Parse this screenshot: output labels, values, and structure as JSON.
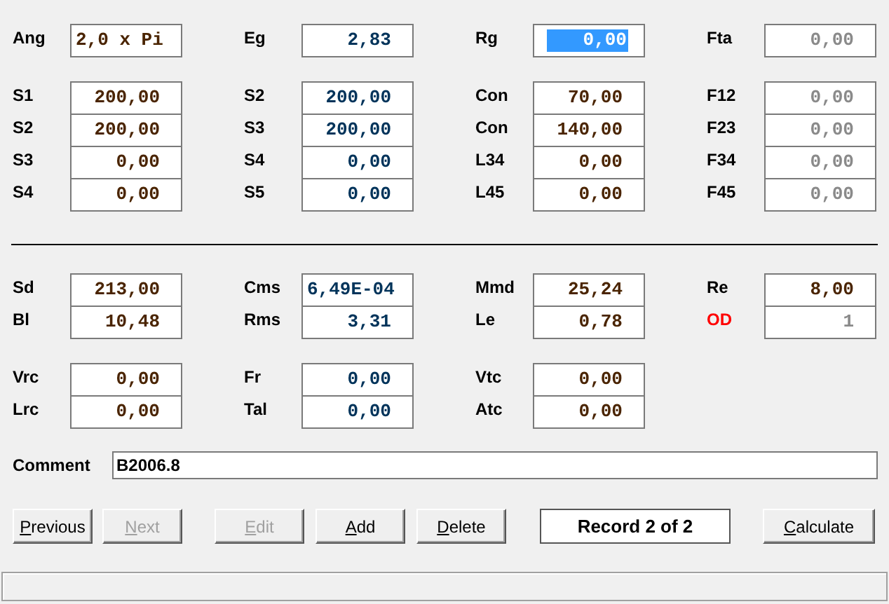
{
  "groups": [
    {
      "rows": [
        [
          {
            "label": "Ang",
            "value": "2,0 x Pi",
            "kind": "text",
            "disabled": false,
            "focused": false,
            "alert": false
          },
          {
            "label": "Eg",
            "value": "2,83",
            "kind": "number",
            "disabled": false,
            "focused": false,
            "alert": false
          },
          {
            "label": "Rg",
            "value": "0,00",
            "kind": "number",
            "disabled": false,
            "focused": true,
            "alert": false
          },
          {
            "label": "Fta",
            "value": "0,00",
            "kind": "number",
            "disabled": true,
            "focused": false,
            "alert": false
          }
        ]
      ]
    },
    {
      "rows": [
        [
          {
            "label": "S1",
            "value": "200,00",
            "kind": "number",
            "disabled": false,
            "focused": false,
            "alert": false
          },
          {
            "label": "S2",
            "value": "200,00",
            "kind": "number",
            "disabled": false,
            "focused": false,
            "alert": false
          },
          {
            "label": "Con",
            "value": "70,00",
            "kind": "number",
            "disabled": false,
            "focused": false,
            "alert": false
          },
          {
            "label": "F12",
            "value": "0,00",
            "kind": "number",
            "disabled": true,
            "focused": false,
            "alert": false
          }
        ],
        [
          {
            "label": "S2",
            "value": "200,00",
            "kind": "number",
            "disabled": false,
            "focused": false,
            "alert": false
          },
          {
            "label": "S3",
            "value": "200,00",
            "kind": "number",
            "disabled": false,
            "focused": false,
            "alert": false
          },
          {
            "label": "Con",
            "value": "140,00",
            "kind": "number",
            "disabled": false,
            "focused": false,
            "alert": false
          },
          {
            "label": "F23",
            "value": "0,00",
            "kind": "number",
            "disabled": true,
            "focused": false,
            "alert": false
          }
        ],
        [
          {
            "label": "S3",
            "value": "0,00",
            "kind": "number",
            "disabled": false,
            "focused": false,
            "alert": false
          },
          {
            "label": "S4",
            "value": "0,00",
            "kind": "number",
            "disabled": false,
            "focused": false,
            "alert": false
          },
          {
            "label": "L34",
            "value": "0,00",
            "kind": "number",
            "disabled": false,
            "focused": false,
            "alert": false
          },
          {
            "label": "F34",
            "value": "0,00",
            "kind": "number",
            "disabled": true,
            "focused": false,
            "alert": false
          }
        ],
        [
          {
            "label": "S4",
            "value": "0,00",
            "kind": "number",
            "disabled": false,
            "focused": false,
            "alert": false
          },
          {
            "label": "S5",
            "value": "0,00",
            "kind": "number",
            "disabled": false,
            "focused": false,
            "alert": false
          },
          {
            "label": "L45",
            "value": "0,00",
            "kind": "number",
            "disabled": false,
            "focused": false,
            "alert": false
          },
          {
            "label": "F45",
            "value": "0,00",
            "kind": "number",
            "disabled": true,
            "focused": false,
            "alert": false
          }
        ]
      ]
    },
    {
      "rows": [
        [
          {
            "label": "Sd",
            "value": "213,00",
            "kind": "number",
            "disabled": false,
            "focused": false,
            "alert": false
          },
          {
            "label": "Cms",
            "value": "6,49E-04",
            "kind": "text",
            "disabled": false,
            "focused": false,
            "alert": false
          },
          {
            "label": "Mmd",
            "value": "25,24",
            "kind": "number",
            "disabled": false,
            "focused": false,
            "alert": false
          },
          {
            "label": "Re",
            "value": "8,00",
            "kind": "number",
            "disabled": false,
            "focused": false,
            "alert": false
          }
        ],
        [
          {
            "label": "Bl",
            "value": "10,48",
            "kind": "number",
            "disabled": false,
            "focused": false,
            "alert": false
          },
          {
            "label": "Rms",
            "value": "3,31",
            "kind": "number",
            "disabled": false,
            "focused": false,
            "alert": false
          },
          {
            "label": "Le",
            "value": "0,78",
            "kind": "number",
            "disabled": false,
            "focused": false,
            "alert": false
          },
          {
            "label": "OD",
            "value": "1",
            "kind": "number",
            "disabled": true,
            "focused": false,
            "alert": true
          }
        ]
      ]
    },
    {
      "rows": [
        [
          {
            "label": "Vrc",
            "value": "0,00",
            "kind": "number",
            "disabled": false,
            "focused": false,
            "alert": false
          },
          {
            "label": "Fr",
            "value": "0,00",
            "kind": "number",
            "disabled": false,
            "focused": false,
            "alert": false
          },
          {
            "label": "Vtc",
            "value": "0,00",
            "kind": "number",
            "disabled": false,
            "focused": false,
            "alert": false
          }
        ],
        [
          {
            "label": "Lrc",
            "value": "0,00",
            "kind": "number",
            "disabled": false,
            "focused": false,
            "alert": false
          },
          {
            "label": "Tal",
            "value": "0,00",
            "kind": "number",
            "disabled": false,
            "focused": false,
            "alert": false
          },
          {
            "label": "Atc",
            "value": "0,00",
            "kind": "number",
            "disabled": false,
            "focused": false,
            "alert": false
          }
        ]
      ]
    }
  ],
  "comment": {
    "label": "Comment",
    "value": "B2006.8"
  },
  "buttons": [
    {
      "label": "Previous",
      "disabled": false
    },
    {
      "label": "Next",
      "disabled": true
    },
    {
      "label": "Edit",
      "disabled": true
    },
    {
      "label": "Add",
      "disabled": false
    },
    {
      "label": "Delete",
      "disabled": false
    }
  ],
  "record": "Record 2 of 2",
  "calculate": {
    "label": "Calculate",
    "disabled": false
  }
}
